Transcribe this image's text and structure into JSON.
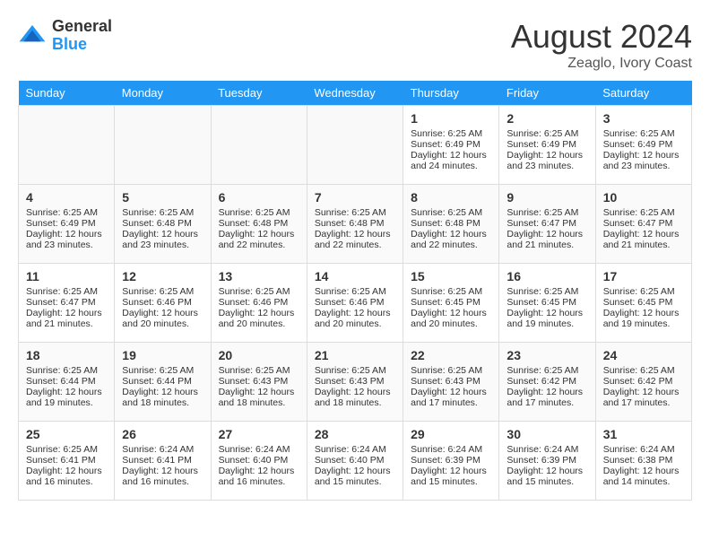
{
  "header": {
    "logo_general": "General",
    "logo_blue": "Blue",
    "month_year": "August 2024",
    "location": "Zeaglo, Ivory Coast"
  },
  "days_of_week": [
    "Sunday",
    "Monday",
    "Tuesday",
    "Wednesday",
    "Thursday",
    "Friday",
    "Saturday"
  ],
  "weeks": [
    [
      {
        "day": "",
        "info": ""
      },
      {
        "day": "",
        "info": ""
      },
      {
        "day": "",
        "info": ""
      },
      {
        "day": "",
        "info": ""
      },
      {
        "day": "1",
        "info": "Sunrise: 6:25 AM\nSunset: 6:49 PM\nDaylight: 12 hours\nand 24 minutes."
      },
      {
        "day": "2",
        "info": "Sunrise: 6:25 AM\nSunset: 6:49 PM\nDaylight: 12 hours\nand 23 minutes."
      },
      {
        "day": "3",
        "info": "Sunrise: 6:25 AM\nSunset: 6:49 PM\nDaylight: 12 hours\nand 23 minutes."
      }
    ],
    [
      {
        "day": "4",
        "info": "Sunrise: 6:25 AM\nSunset: 6:49 PM\nDaylight: 12 hours\nand 23 minutes."
      },
      {
        "day": "5",
        "info": "Sunrise: 6:25 AM\nSunset: 6:48 PM\nDaylight: 12 hours\nand 23 minutes."
      },
      {
        "day": "6",
        "info": "Sunrise: 6:25 AM\nSunset: 6:48 PM\nDaylight: 12 hours\nand 22 minutes."
      },
      {
        "day": "7",
        "info": "Sunrise: 6:25 AM\nSunset: 6:48 PM\nDaylight: 12 hours\nand 22 minutes."
      },
      {
        "day": "8",
        "info": "Sunrise: 6:25 AM\nSunset: 6:48 PM\nDaylight: 12 hours\nand 22 minutes."
      },
      {
        "day": "9",
        "info": "Sunrise: 6:25 AM\nSunset: 6:47 PM\nDaylight: 12 hours\nand 21 minutes."
      },
      {
        "day": "10",
        "info": "Sunrise: 6:25 AM\nSunset: 6:47 PM\nDaylight: 12 hours\nand 21 minutes."
      }
    ],
    [
      {
        "day": "11",
        "info": "Sunrise: 6:25 AM\nSunset: 6:47 PM\nDaylight: 12 hours\nand 21 minutes."
      },
      {
        "day": "12",
        "info": "Sunrise: 6:25 AM\nSunset: 6:46 PM\nDaylight: 12 hours\nand 20 minutes."
      },
      {
        "day": "13",
        "info": "Sunrise: 6:25 AM\nSunset: 6:46 PM\nDaylight: 12 hours\nand 20 minutes."
      },
      {
        "day": "14",
        "info": "Sunrise: 6:25 AM\nSunset: 6:46 PM\nDaylight: 12 hours\nand 20 minutes."
      },
      {
        "day": "15",
        "info": "Sunrise: 6:25 AM\nSunset: 6:45 PM\nDaylight: 12 hours\nand 20 minutes."
      },
      {
        "day": "16",
        "info": "Sunrise: 6:25 AM\nSunset: 6:45 PM\nDaylight: 12 hours\nand 19 minutes."
      },
      {
        "day": "17",
        "info": "Sunrise: 6:25 AM\nSunset: 6:45 PM\nDaylight: 12 hours\nand 19 minutes."
      }
    ],
    [
      {
        "day": "18",
        "info": "Sunrise: 6:25 AM\nSunset: 6:44 PM\nDaylight: 12 hours\nand 19 minutes."
      },
      {
        "day": "19",
        "info": "Sunrise: 6:25 AM\nSunset: 6:44 PM\nDaylight: 12 hours\nand 18 minutes."
      },
      {
        "day": "20",
        "info": "Sunrise: 6:25 AM\nSunset: 6:43 PM\nDaylight: 12 hours\nand 18 minutes."
      },
      {
        "day": "21",
        "info": "Sunrise: 6:25 AM\nSunset: 6:43 PM\nDaylight: 12 hours\nand 18 minutes."
      },
      {
        "day": "22",
        "info": "Sunrise: 6:25 AM\nSunset: 6:43 PM\nDaylight: 12 hours\nand 17 minutes."
      },
      {
        "day": "23",
        "info": "Sunrise: 6:25 AM\nSunset: 6:42 PM\nDaylight: 12 hours\nand 17 minutes."
      },
      {
        "day": "24",
        "info": "Sunrise: 6:25 AM\nSunset: 6:42 PM\nDaylight: 12 hours\nand 17 minutes."
      }
    ],
    [
      {
        "day": "25",
        "info": "Sunrise: 6:25 AM\nSunset: 6:41 PM\nDaylight: 12 hours\nand 16 minutes."
      },
      {
        "day": "26",
        "info": "Sunrise: 6:24 AM\nSunset: 6:41 PM\nDaylight: 12 hours\nand 16 minutes."
      },
      {
        "day": "27",
        "info": "Sunrise: 6:24 AM\nSunset: 6:40 PM\nDaylight: 12 hours\nand 16 minutes."
      },
      {
        "day": "28",
        "info": "Sunrise: 6:24 AM\nSunset: 6:40 PM\nDaylight: 12 hours\nand 15 minutes."
      },
      {
        "day": "29",
        "info": "Sunrise: 6:24 AM\nSunset: 6:39 PM\nDaylight: 12 hours\nand 15 minutes."
      },
      {
        "day": "30",
        "info": "Sunrise: 6:24 AM\nSunset: 6:39 PM\nDaylight: 12 hours\nand 15 minutes."
      },
      {
        "day": "31",
        "info": "Sunrise: 6:24 AM\nSunset: 6:38 PM\nDaylight: 12 hours\nand 14 minutes."
      }
    ]
  ]
}
